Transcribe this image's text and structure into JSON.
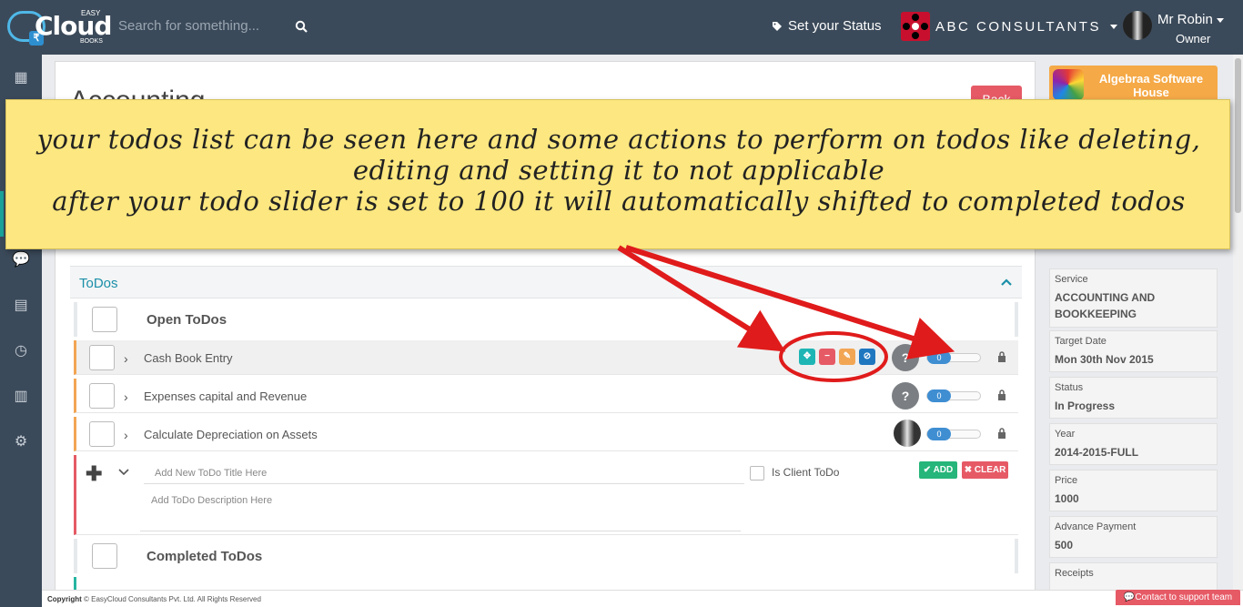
{
  "header": {
    "logo_top": "EASY",
    "logo_word": "Cloud",
    "logo_bottom": "BOOKS",
    "search_placeholder": "Search for something...",
    "status_label": "Set your Status",
    "company_name": "ABC CONSULTANTS",
    "user_name": "Mr Robin",
    "user_role": "Owner"
  },
  "page": {
    "title": "Accounting",
    "back_label": "Back"
  },
  "todos": {
    "section_title": "ToDos",
    "open_group": "Open ToDos",
    "completed_group": "Completed ToDos",
    "items": [
      {
        "title": "Cash Book Entry",
        "progress": "0"
      },
      {
        "title": "Expenses capital and Revenue",
        "progress": "0"
      },
      {
        "title": "Calculate Depreciation on Assets",
        "progress": "0"
      }
    ],
    "new_title_placeholder": "Add New ToDo Title Here",
    "new_desc_placeholder": "Add ToDo Description Here",
    "is_client_label": "Is Client ToDo",
    "add_label": "ADD",
    "clear_label": "CLEAR"
  },
  "right": {
    "client_name": "Algebraa Software House",
    "cards": [
      {
        "label": "Service",
        "value": "ACCOUNTING AND BOOKKEEPING"
      },
      {
        "label": "Target Date",
        "value": "Mon 30th Nov 2015"
      },
      {
        "label": "Status",
        "value": "In Progress"
      },
      {
        "label": "Year",
        "value": "2014-2015-FULL"
      },
      {
        "label": "Price",
        "value": "1000"
      },
      {
        "label": "Advance Payment",
        "value": "500"
      },
      {
        "label": "Receipts",
        "value": ""
      }
    ]
  },
  "footer": {
    "copyright_bold": "Copyright",
    "copyright_text": "© EasyCloud Consultants Pvt. Ltd. All Rights Reserved",
    "support_label": "Contact to support team"
  },
  "annotation": {
    "line1": "your todos list can be seen here and some actions to perform on todos like deleting, editing and setting it to not applicable",
    "line2": "after your todo slider is set to 100 it will automatically shifted to completed todos"
  },
  "colors": {
    "topbar": "#3b4a5a",
    "accent_teal": "#1a8fa8",
    "danger": "#e65a66",
    "success": "#26b57a",
    "note_yellow": "#fce780",
    "arrow_red": "#e01b1b"
  },
  "icons": [
    "search-icon",
    "tag-icon",
    "caret-down-icon",
    "dashboard-icon",
    "chat-icon",
    "document-icon",
    "clock-icon",
    "news-icon",
    "gear-icon",
    "chevron-up-icon",
    "chevron-right-icon",
    "move-icon",
    "minus-icon",
    "edit-icon",
    "ban-icon",
    "lock-icon",
    "plus-icon",
    "chevron-down-icon",
    "check-icon",
    "close-icon",
    "comment-icon"
  ]
}
